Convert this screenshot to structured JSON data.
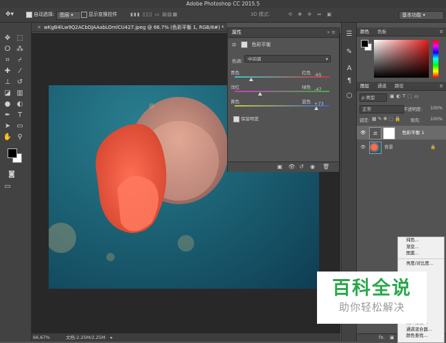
{
  "app_title": "Adobe Photoshop CC 2015.5",
  "options_bar": {
    "auto_select_label": "自动选择:",
    "auto_select_value": "图层",
    "show_transform_label": "显示变换控件",
    "mode_3d_label": "3D 模式:",
    "workspace": "基本功能"
  },
  "document": {
    "tab_title": "wKgB4lLw9Q2ACbDJAAabLOmlCU427.jpeg @ 66.7% (色彩平衡 1, RGB/8#) *",
    "zoom": "66.67%",
    "doc_size": "文档:2.25M/2.25M"
  },
  "properties": {
    "panel_title": "属性",
    "adjustment_name": "色彩平衡",
    "tone_label": "色调:",
    "tone_value": "中间调",
    "sliders": [
      {
        "left": "青色",
        "right": "红色",
        "value": "-65",
        "level": -65,
        "color": "#c83c3c"
      },
      {
        "left": "洋红",
        "right": "绿色",
        "value": "-47",
        "level": -47,
        "color": "#3cb43c"
      },
      {
        "left": "黄色",
        "right": "蓝色",
        "value": "+73",
        "level": 73,
        "color": "#3c64c8"
      }
    ],
    "preserve_label": "保留明度"
  },
  "color_panel": {
    "tab_color": "颜色",
    "tab_swatches": "色板"
  },
  "layers_panel": {
    "tabs": [
      "图层",
      "通道",
      "路径"
    ],
    "filter_value": "ρ 类型",
    "blend_mode": "正常",
    "opacity_label": "不透明度:",
    "opacity_value": "100%",
    "lock_label": "锁定:",
    "fill_label": "填充:",
    "fill_value": "100%",
    "layers": [
      {
        "name": "色彩平衡 1"
      },
      {
        "name": "背景"
      }
    ]
  },
  "context_menu": {
    "items": [
      "纯色...",
      "渐变...",
      "图案...",
      "亮度/对比度...",
      "照片滤镜...",
      "通道混合器...",
      "颜色查找..."
    ]
  },
  "watermark": {
    "line1": "百科全说",
    "line2": "助你轻松解决"
  }
}
